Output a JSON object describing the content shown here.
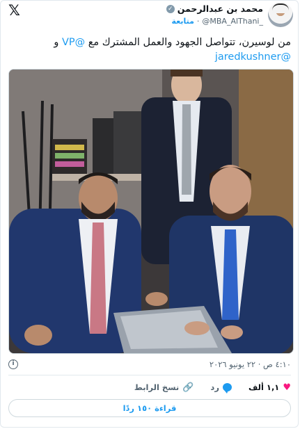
{
  "header": {
    "logo_icon": "x-logo-icon",
    "logo_glyph": "𝕏",
    "display_name": "محمد بن عبدالرحمن",
    "verified_glyph": "✓",
    "handle": "@MBA_AlThani_",
    "dot": "·",
    "follow_label": "متابعة"
  },
  "tweet": {
    "text_prefix": "من لوسيرن، تتواصل الجهود والعمل المشترك مع ",
    "mention_vp": "@VP",
    "conjunction": " و",
    "mention_jk": "@jaredkushner"
  },
  "meta": {
    "info_glyph": "i",
    "timestamp": "٤:١٠ ص · ٢٢ يونيو ٢٠٢٦"
  },
  "actions": {
    "like_count": "١,١ ألف",
    "reply_label": "رد",
    "copy_link_label": "نسخ الرابط",
    "heart_glyph": "♥",
    "link_glyph": "🔗"
  },
  "replies_button": "قراءة ١٥٠ ردًا",
  "colors": {
    "accent": "#1d9bf0",
    "like": "#f91880",
    "muted": "#536471"
  }
}
